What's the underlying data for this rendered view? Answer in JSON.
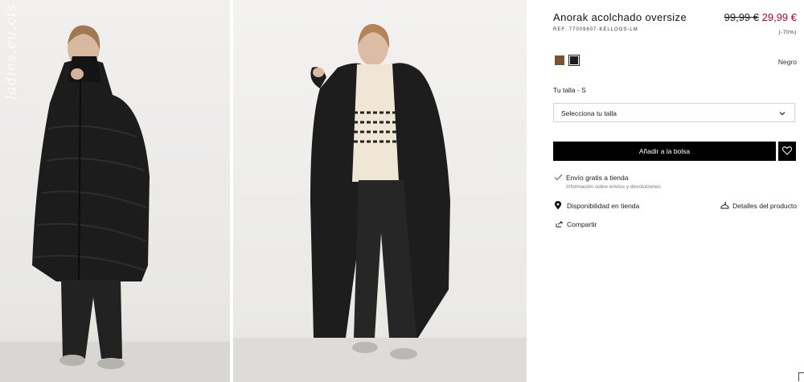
{
  "gallery": {
    "images": [
      {
        "alt": "Modelo con anorak acolchado negro"
      },
      {
        "alt": "Modelo con anorak acolchado negro abierto"
      }
    ],
    "watermark": "ladies.eu.cis"
  },
  "product": {
    "title": "Anorak acolchado oversize",
    "price_old": "99,99 €",
    "price_new": "29,99 €",
    "ref": "REF. 77009607-KELLOGS-LM",
    "discount": "(-70%)",
    "colors": [
      {
        "name": "brown",
        "hex": "#7a5330"
      },
      {
        "name": "black",
        "hex": "#1b1b1b",
        "selected": true
      }
    ],
    "selected_color": "Negro",
    "size_label": "Tu talla - S",
    "size_placeholder": "Selecciona tu talla",
    "add_to_bag": "Añadir a la bolsa"
  },
  "services": {
    "shipping_title": "Envío gratis a tienda",
    "shipping_sub": "Información sobre envíos y devoluciones",
    "availability": "Disponibilidad en tienda",
    "details": "Detalles del producto",
    "share": "Compartir"
  },
  "colors": {
    "accent_price": "#c4002d",
    "button": "#000000"
  }
}
